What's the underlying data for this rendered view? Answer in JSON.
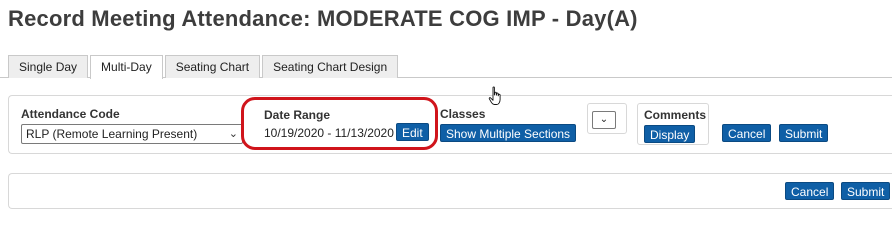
{
  "header": {
    "title": "Record Meeting Attendance: MODERATE COG IMP - Day(A)"
  },
  "tabs": [
    {
      "label": "Single Day",
      "active": false
    },
    {
      "label": "Multi-Day",
      "active": true
    },
    {
      "label": "Seating Chart",
      "active": false
    },
    {
      "label": "Seating Chart Design",
      "active": false
    }
  ],
  "form": {
    "attendance_code": {
      "label": "Attendance Code",
      "value": "RLP (Remote Learning Present)"
    },
    "date_range": {
      "label": "Date Range",
      "value": "10/19/2020 - 11/13/2020",
      "edit_label": "Edit"
    },
    "classes": {
      "label": "Classes",
      "button_label": "Show Multiple Sections"
    },
    "comments": {
      "label": "Comments",
      "button_label": "Display"
    },
    "cancel_label": "Cancel",
    "submit_label": "Submit"
  },
  "footer_actions": {
    "cancel_label": "Cancel",
    "submit_label": "Submit"
  },
  "colors": {
    "button_bg": "#0f5fa6",
    "highlight": "#d0141b"
  },
  "icons": {
    "cursor": "hand-pointer-icon",
    "dropdown": "chevron-down-icon"
  }
}
